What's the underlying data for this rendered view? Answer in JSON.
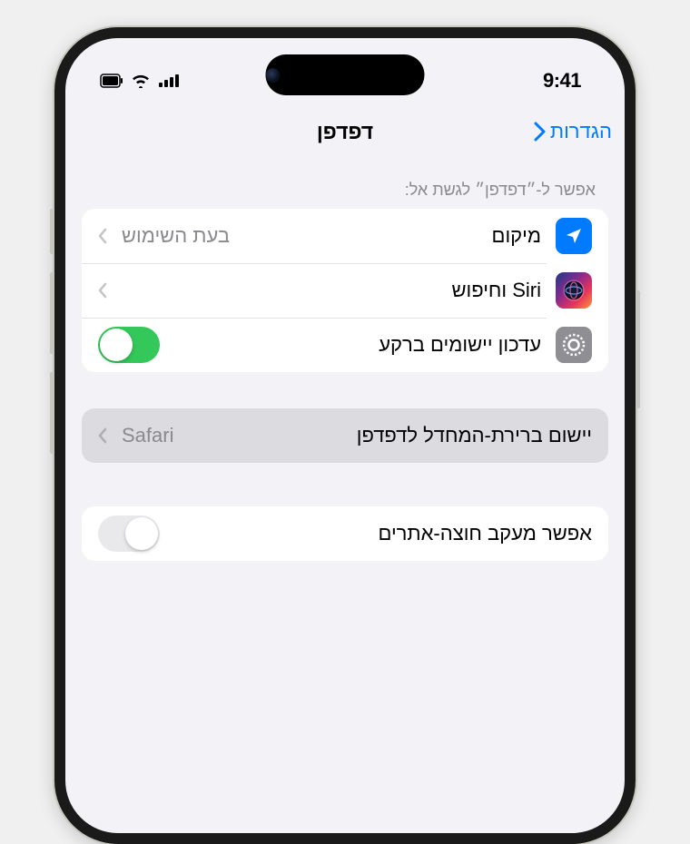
{
  "status": {
    "time": "9:41"
  },
  "nav": {
    "title": "דפדפן",
    "back": "הגדרות"
  },
  "section1": {
    "header": "אפשר ל-״דפדפן״ לגשת אל:",
    "location": {
      "label": "מיקום",
      "value": "בעת השימוש"
    },
    "siri": {
      "label": "Siri וחיפוש"
    },
    "refresh": {
      "label": "עדכון יישומים ברקע",
      "on": true
    }
  },
  "section2": {
    "default": {
      "label": "יישום ברירת-המחדל לדפדפן",
      "value": "Safari"
    }
  },
  "section3": {
    "tracking": {
      "label": "אפשר מעקב חוצה-אתרים",
      "on": false
    }
  }
}
